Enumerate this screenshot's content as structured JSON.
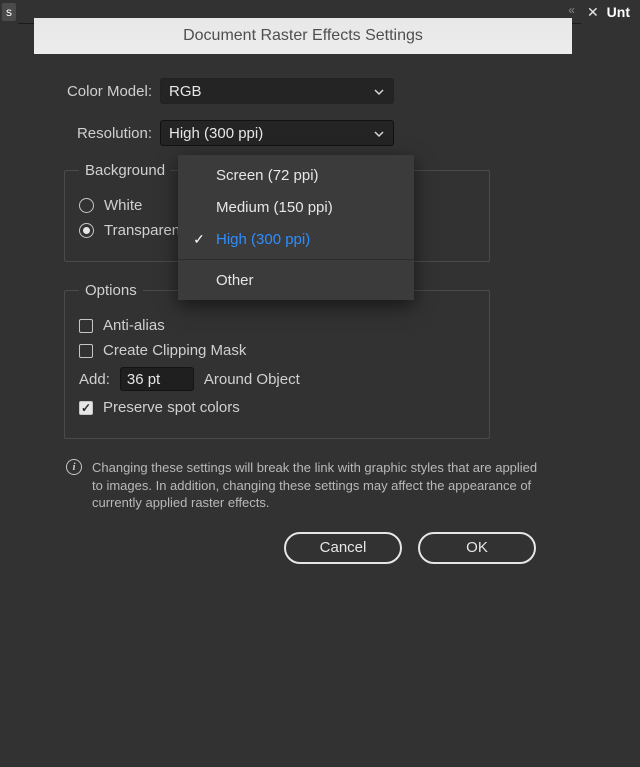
{
  "topbar": {
    "tab_s": "s",
    "filename": "Unt"
  },
  "title": "Document Raster Effects Settings",
  "color_model": {
    "label": "Color Model:",
    "value": "RGB"
  },
  "resolution": {
    "label": "Resolution:",
    "value": "High (300 ppi)",
    "options": [
      "Screen (72 ppi)",
      "Medium (150 ppi)",
      "High (300 ppi)",
      "Other"
    ],
    "selected_index": 2
  },
  "background": {
    "legend": "Background",
    "white": "White",
    "transparent": "Transparent",
    "selected": "transparent"
  },
  "options": {
    "legend": "Options",
    "anti_alias": {
      "label": "Anti-alias",
      "checked": false
    },
    "clipping": {
      "label": "Create Clipping Mask",
      "checked": false
    },
    "add": {
      "label": "Add:",
      "value": "36 pt",
      "suffix": "Around Object"
    },
    "preserve": {
      "label": "Preserve spot colors",
      "checked": true
    }
  },
  "info": "Changing these settings will break the link with graphic styles that are applied to images. In addition, changing these settings may affect the appearance of currently applied raster effects.",
  "buttons": {
    "cancel": "Cancel",
    "ok": "OK"
  }
}
